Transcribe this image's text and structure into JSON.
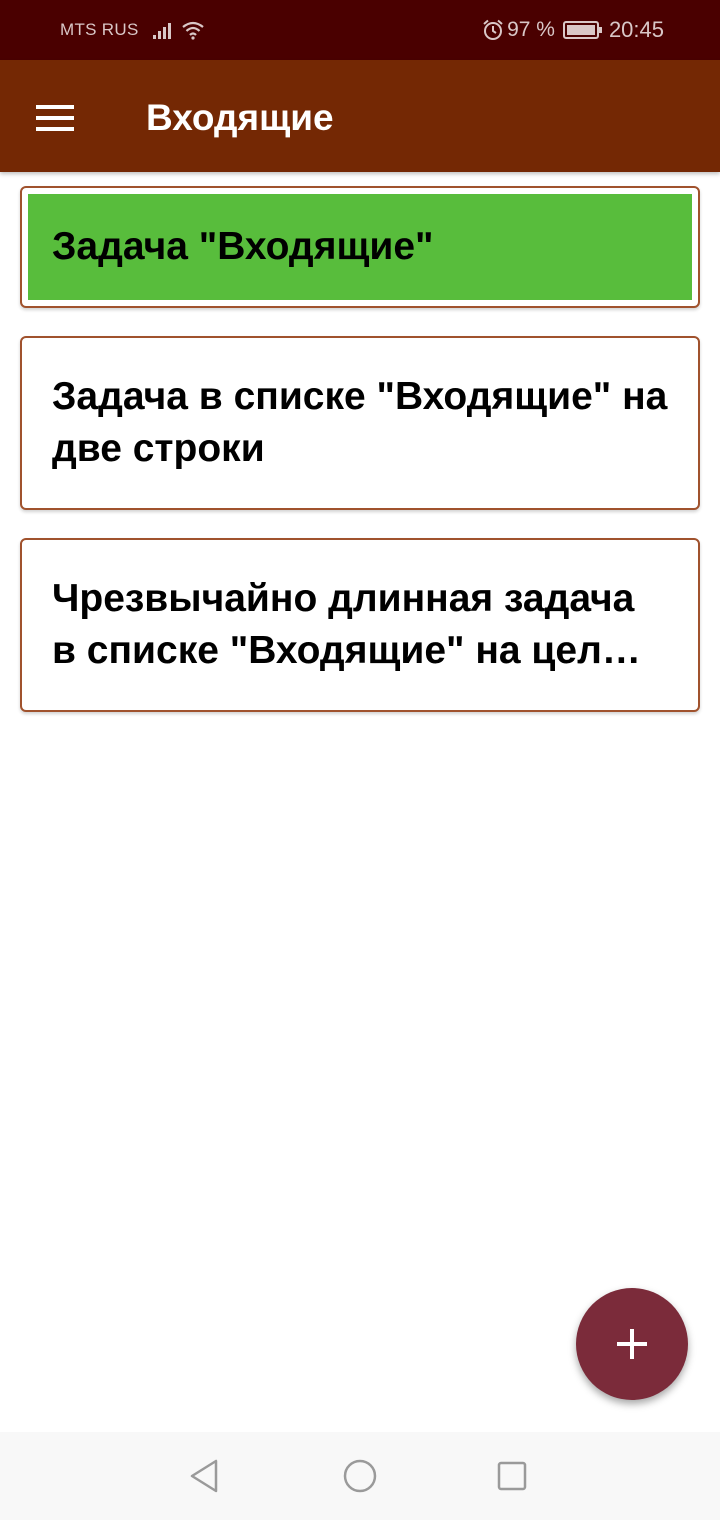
{
  "status_bar": {
    "carrier": "MTS RUS",
    "battery_percent": "97 %",
    "time": "20:45",
    "icons": [
      "signal-icon",
      "wifi-icon",
      "alarm-icon",
      "battery-icon"
    ]
  },
  "app_bar": {
    "title": "Входящие",
    "menu_icon": "hamburger-menu-icon"
  },
  "tasks": [
    {
      "text": "Задача \"Входящие\"",
      "selected": true
    },
    {
      "text": "Задача в списке \"Входящие\" на две строки",
      "selected": false
    },
    {
      "text": "Чрезвычайно длинная задача в списке \"Входящие\" на целых три строки",
      "selected": false
    }
  ],
  "fab": {
    "icon": "plus-icon"
  },
  "nav_bar": {
    "icons": [
      "back-icon",
      "home-icon",
      "recents-icon"
    ]
  },
  "colors": {
    "status_bar": "#4a0000",
    "app_bar": "#742804",
    "card_border": "#a0522d",
    "selected_task": "#58bd3c",
    "fab": "#7b2b3a",
    "nav_bar": "#f8f8f8"
  }
}
